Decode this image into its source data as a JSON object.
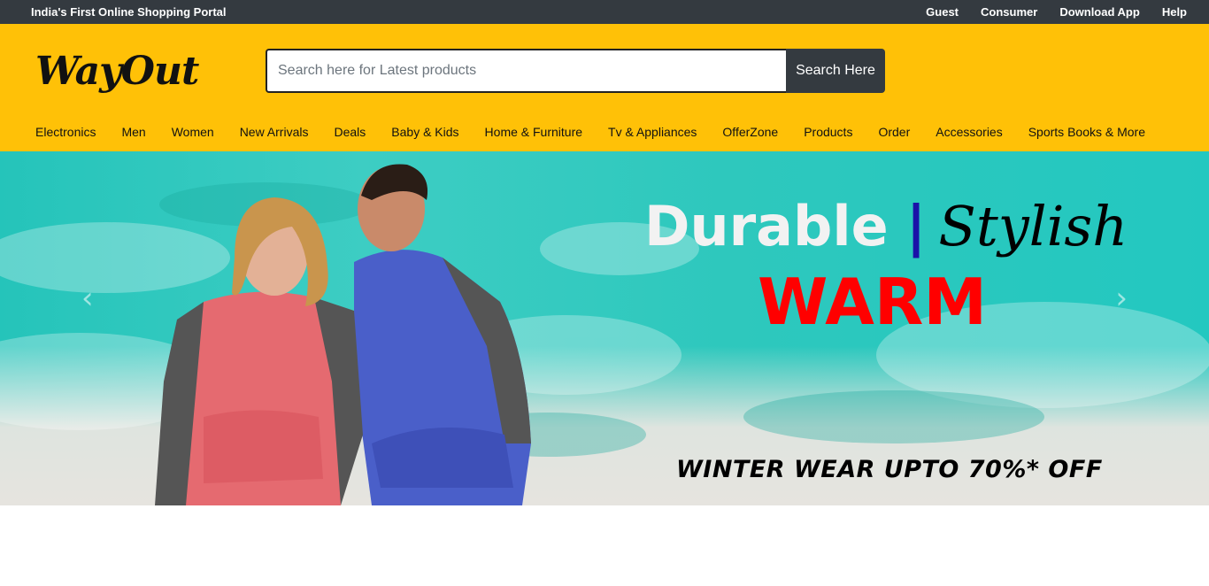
{
  "topbar": {
    "tagline": "India's First Online Shopping Portal",
    "links": [
      "Guest",
      "Consumer",
      "Download App",
      "Help"
    ]
  },
  "header": {
    "logo": "WayOut",
    "search": {
      "placeholder": "Search here for Latest products",
      "value": "",
      "button_label": "Search Here"
    },
    "nav": [
      "Electronics",
      "Men",
      "Women",
      "New Arrivals",
      "Deals",
      "Baby & Kids",
      "Home & Furniture",
      "Tv & Appliances",
      "OfferZone",
      "Products",
      "Order",
      "Accessories",
      "Sports Books & More"
    ]
  },
  "hero": {
    "headline_1": "Durable",
    "separator": "|",
    "headline_2": "Stylish",
    "headline_3": "WARM",
    "offer": "WINTER WEAR UPTO 70%* OFF",
    "prev_icon": "chevron-left-icon",
    "next_icon": "chevron-right-icon"
  },
  "colors": {
    "topbar": "#343a40",
    "header": "#ffc107",
    "banner_teal": "#2ec8bd",
    "warm": "#ff0000",
    "separator": "#1a12a8"
  }
}
